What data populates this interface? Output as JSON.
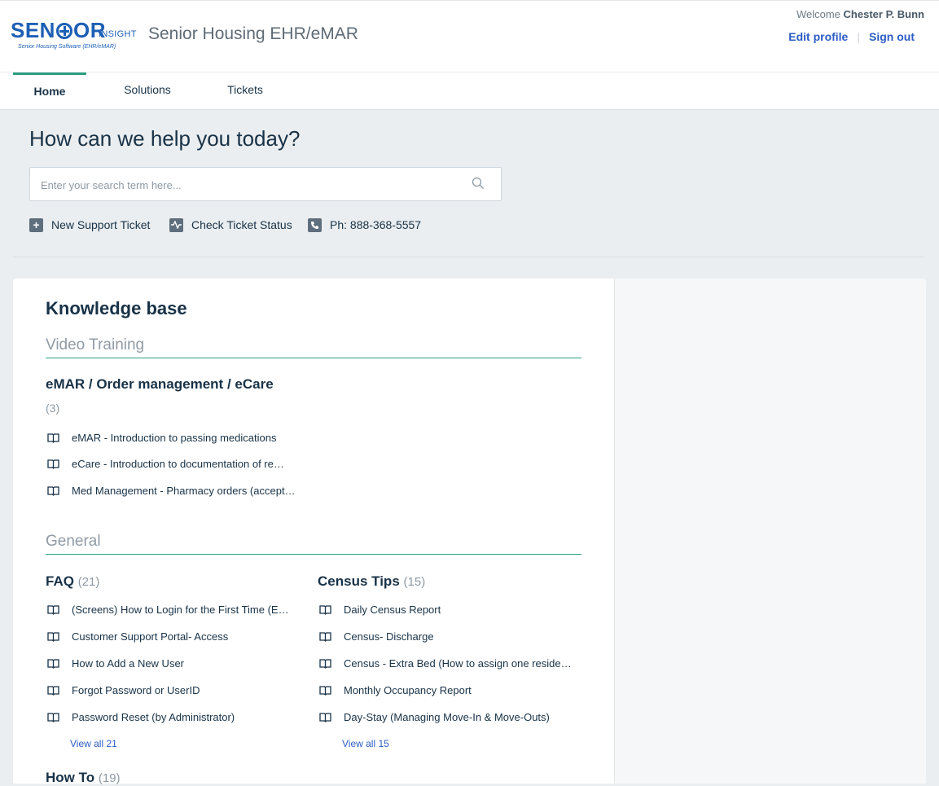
{
  "brand": {
    "logo_main_left": "SEN",
    "logo_main_right": "OR",
    "logo_sub": "INSIGHT",
    "logo_tagline": "Senior Housing Software (EHR/eMAR)",
    "portal_title": "Senior Housing EHR/eMAR"
  },
  "user": {
    "welcome_label": "Welcome",
    "name": "Chester P. Bunn",
    "edit_profile": "Edit profile",
    "sign_out": "Sign out"
  },
  "nav": {
    "tabs": [
      {
        "label": "Home",
        "active": true
      },
      {
        "label": "Solutions"
      },
      {
        "label": "Tickets"
      }
    ]
  },
  "hero": {
    "title": "How can we help you today?",
    "search_placeholder": "Enter your search term here..."
  },
  "quick_links": {
    "new_ticket": "New Support Ticket",
    "check_status": "Check Ticket Status",
    "phone": "Ph: 888-368-5557"
  },
  "kb": {
    "title": "Knowledge base",
    "sections": [
      {
        "name": "Video Training",
        "categories": [
          {
            "title": "eMAR / Order management / eCare",
            "count": "(3)",
            "articles": [
              "eMAR - Introduction to passing medications",
              "eCare - Introduction to documentation of re…",
              "Med Management - Pharmacy orders (accept…"
            ]
          }
        ]
      },
      {
        "name": "General",
        "categories": [
          {
            "title": "FAQ",
            "count": "(21)",
            "articles": [
              "(Screens) How to Login for the First Time (E…",
              "Customer Support Portal- Access",
              "How to Add a New User",
              "Forgot Password or UserID",
              "Password Reset (by Administrator)"
            ],
            "view_all": "View all 21"
          },
          {
            "title": "Census Tips",
            "count": "(15)",
            "articles": [
              "Daily Census Report",
              "Census- Discharge",
              "Census - Extra Bed (How to assign one reside…",
              "Monthly Occupancy Report",
              "Day-Stay (Managing Move-In & Move-Outs)"
            ],
            "view_all": "View all 15"
          }
        ]
      }
    ],
    "partial_category": {
      "title": "How To",
      "count": "(19)"
    }
  },
  "colors": {
    "accent": "#2b9e81",
    "link": "#2c5cc5",
    "brand": "#1d5fb5",
    "text": "#183247",
    "background": "#ebeef0"
  }
}
